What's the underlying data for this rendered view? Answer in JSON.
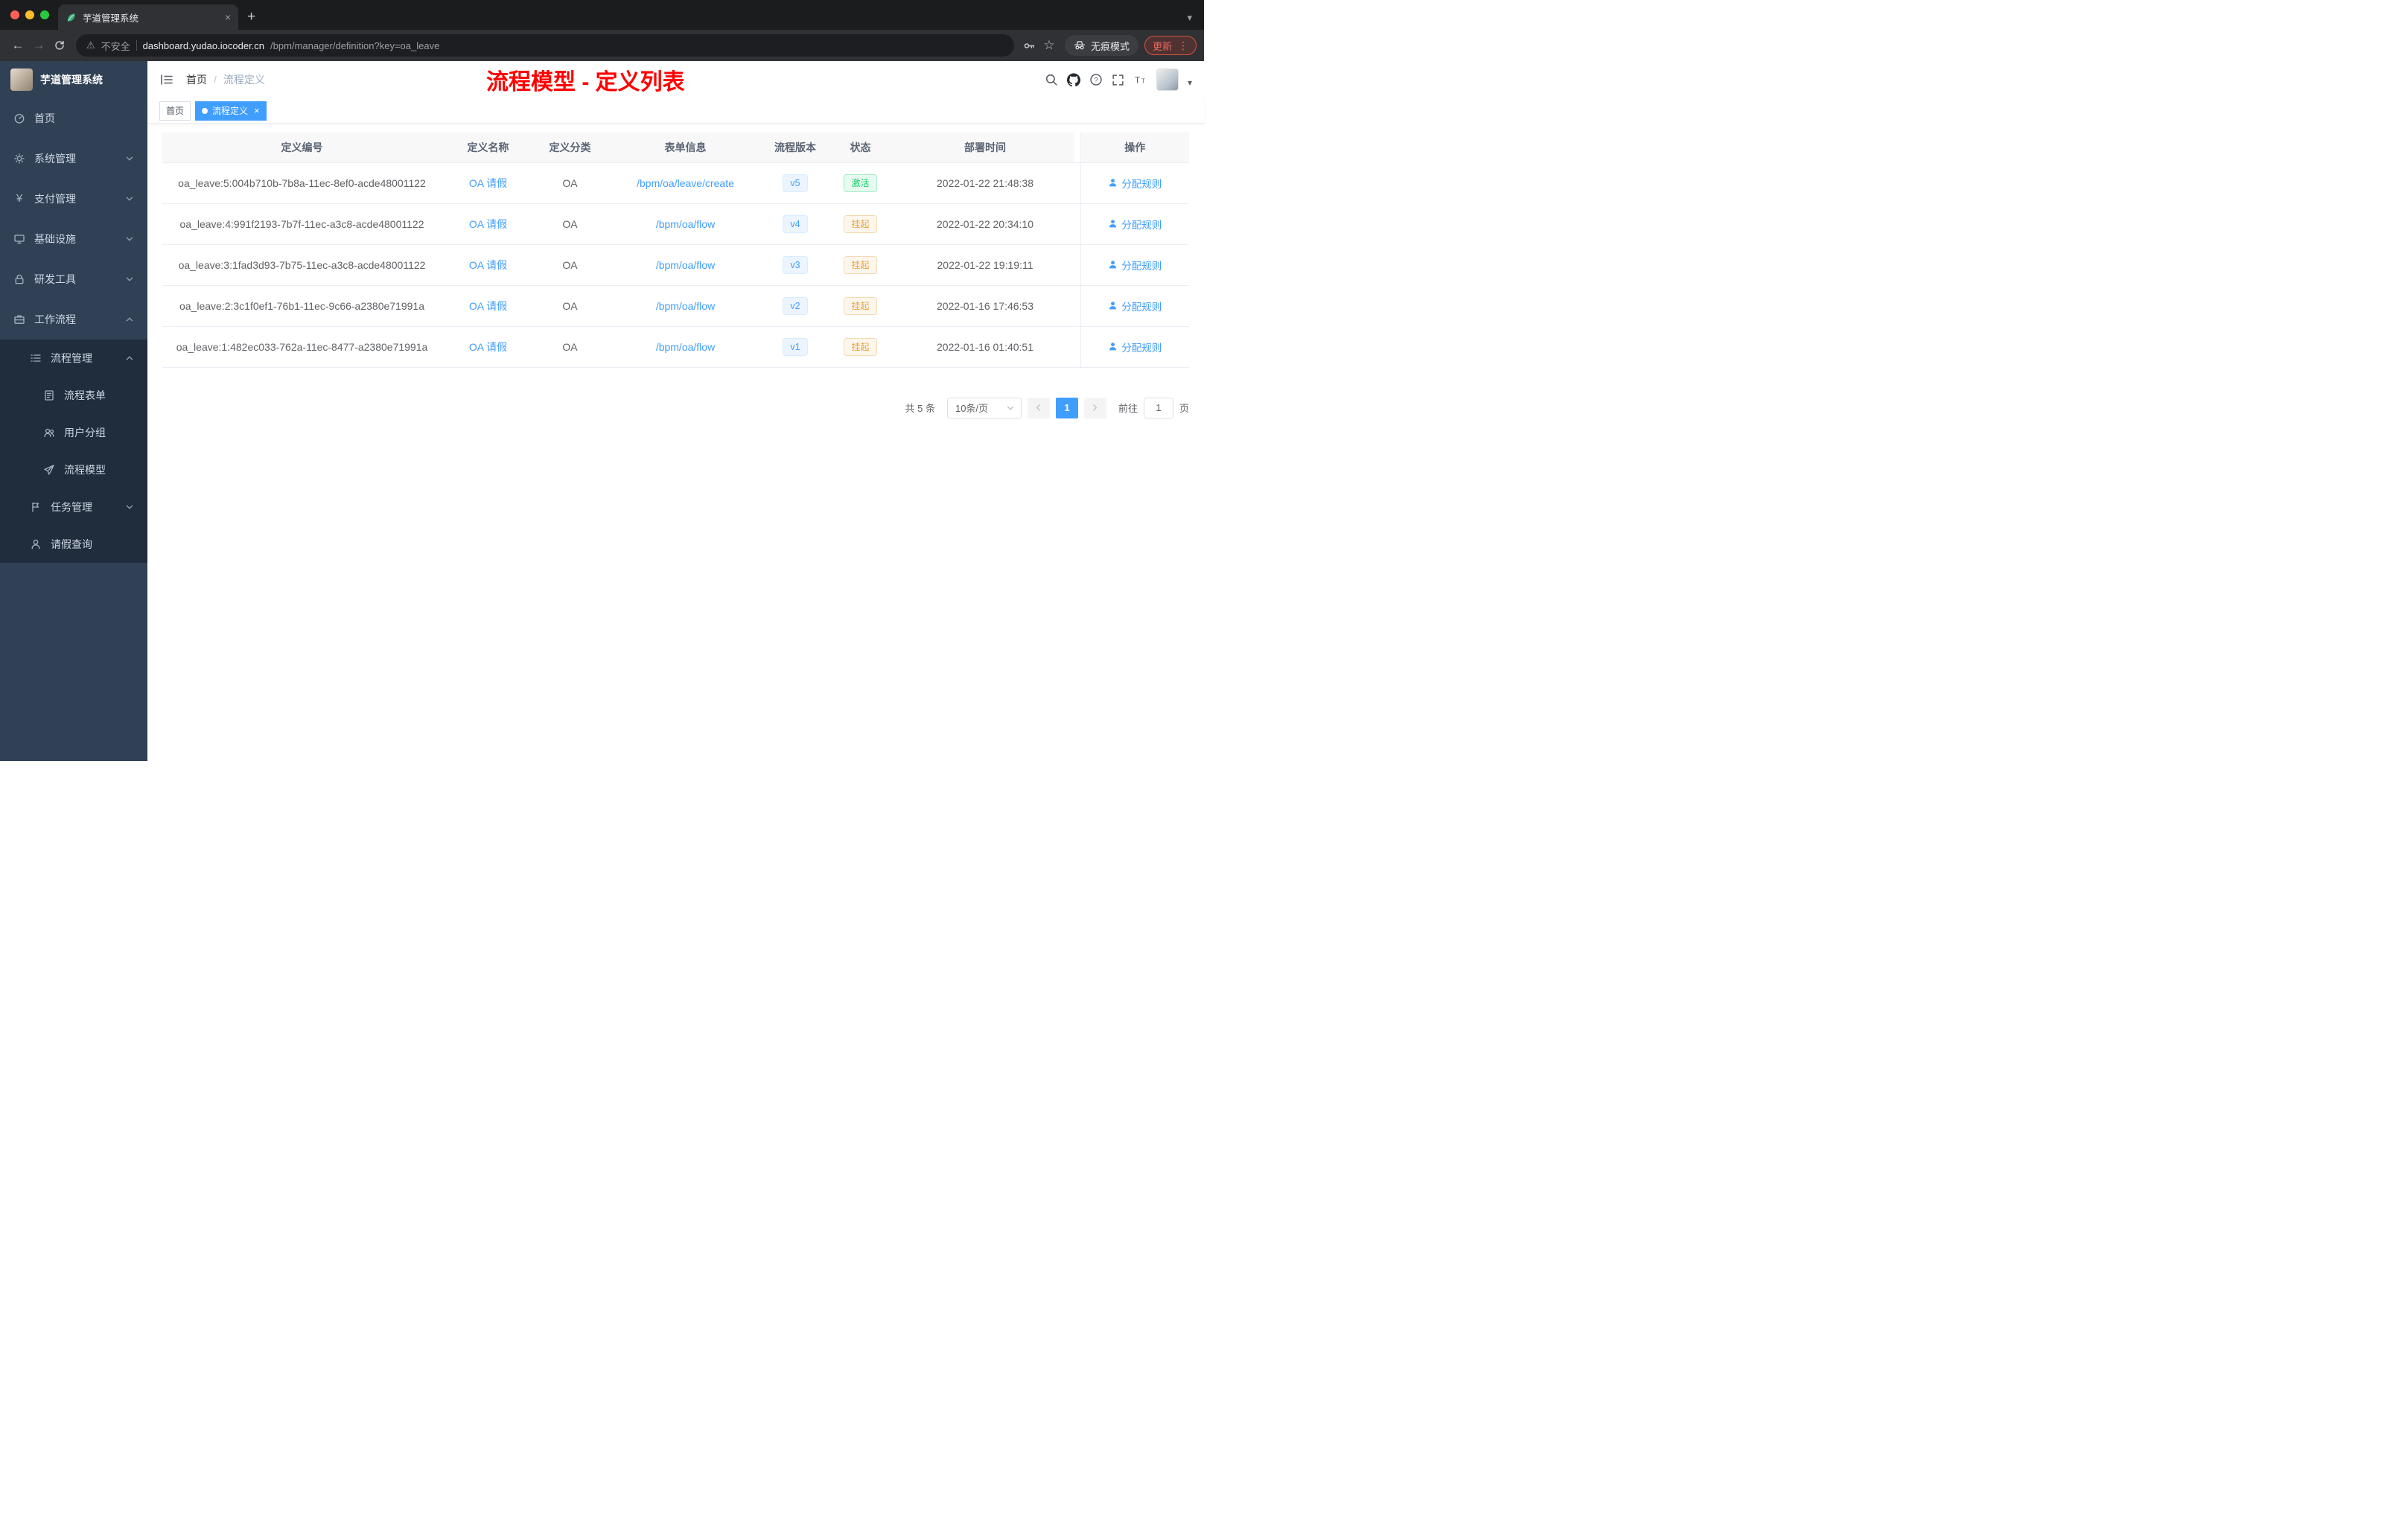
{
  "browser": {
    "tab": {
      "title": "芋道管理系统"
    },
    "address": {
      "security_label": "不安全",
      "host": "dashboard.yudao.iocoder.cn",
      "path": "/bpm/manager/definition?key=oa_leave"
    },
    "incognito_label": "无痕模式",
    "update_label": "更新"
  },
  "icons": {
    "close": "×",
    "plus": "+",
    "caret_down": "▾",
    "back": "←",
    "forward": "→",
    "star": "☆",
    "warning": "⚠",
    "menu_dots": "⋮",
    "yen": "¥"
  },
  "sidebar": {
    "app_title": "芋道管理系统",
    "items": [
      {
        "label": "首页"
      },
      {
        "label": "系统管理"
      },
      {
        "label": "支付管理"
      },
      {
        "label": "基础设施"
      },
      {
        "label": "研发工具"
      },
      {
        "label": "工作流程"
      },
      {
        "label": "流程管理"
      },
      {
        "label": "流程表单"
      },
      {
        "label": "用户分组"
      },
      {
        "label": "流程模型"
      },
      {
        "label": "任务管理"
      },
      {
        "label": "请假查询"
      }
    ]
  },
  "header": {
    "breadcrumb": {
      "home": "首页",
      "sep": "/",
      "current": "流程定义"
    },
    "annotation": "流程模型 - 定义列表"
  },
  "tags": {
    "home": "首页",
    "active": "流程定义"
  },
  "table": {
    "columns": [
      "定义编号",
      "定义名称",
      "定义分类",
      "表单信息",
      "流程版本",
      "状态",
      "部署时间",
      "操作"
    ],
    "action_label": "分配规则",
    "rows": [
      {
        "id": "oa_leave:5:004b710b-7b8a-11ec-8ef0-acde48001122",
        "name": "OA 请假",
        "category": "OA",
        "form": "/bpm/oa/leave/create",
        "version": "v5",
        "status": "激活",
        "status_type": "success",
        "time": "2022-01-22 21:48:38"
      },
      {
        "id": "oa_leave:4:991f2193-7b7f-11ec-a3c8-acde48001122",
        "name": "OA 请假",
        "category": "OA",
        "form": "/bpm/oa/flow",
        "version": "v4",
        "status": "挂起",
        "status_type": "warning",
        "time": "2022-01-22 20:34:10"
      },
      {
        "id": "oa_leave:3:1fad3d93-7b75-11ec-a3c8-acde48001122",
        "name": "OA 请假",
        "category": "OA",
        "form": "/bpm/oa/flow",
        "version": "v3",
        "status": "挂起",
        "status_type": "warning",
        "time": "2022-01-22 19:19:11"
      },
      {
        "id": "oa_leave:2:3c1f0ef1-76b1-11ec-9c66-a2380e71991a",
        "name": "OA 请假",
        "category": "OA",
        "form": "/bpm/oa/flow",
        "version": "v2",
        "status": "挂起",
        "status_type": "warning",
        "time": "2022-01-16 17:46:53"
      },
      {
        "id": "oa_leave:1:482ec033-762a-11ec-8477-a2380e71991a",
        "name": "OA 请假",
        "category": "OA",
        "form": "/bpm/oa/flow",
        "version": "v1",
        "status": "挂起",
        "status_type": "warning",
        "time": "2022-01-16 01:40:51"
      }
    ]
  },
  "pagination": {
    "total": "共 5 条",
    "page_size": "10条/页",
    "current_page": "1",
    "goto_label": "前往",
    "goto_value": "1",
    "page_label": "页"
  },
  "colors": {
    "accent": "#409eff",
    "annotation_red": "#ff0000",
    "status_active": "#13ce66",
    "status_suspended": "#e6a23c",
    "sidebar_bg": "#304156",
    "submenu_bg": "#1f2d3d"
  }
}
